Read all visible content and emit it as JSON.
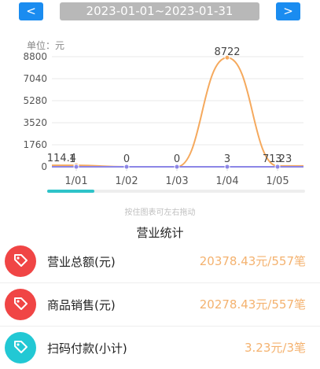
{
  "header": {
    "prev_label": "<",
    "next_label": ">",
    "date_range": "2023-01-01~2023-01-31"
  },
  "chart_data": {
    "type": "line",
    "unit_label": "单位：元",
    "x": [
      "1/01",
      "1/02",
      "1/03",
      "1/04",
      "1/05"
    ],
    "y_ticks": [
      "8800",
      "7040",
      "5280",
      "3520",
      "1760",
      "0"
    ],
    "ylim": [
      0,
      8800
    ],
    "series": [
      {
        "color": "#f5a95d",
        "values": [
          114.4,
          0,
          0,
          8722,
          71.23
        ],
        "labels": [
          "114.4",
          "0",
          "0",
          "8722",
          "71.23"
        ]
      },
      {
        "color": "#8c86e6",
        "values": [
          1,
          0,
          0,
          3,
          3
        ],
        "labels": [
          "1",
          "",
          "",
          "3",
          "3"
        ]
      }
    ],
    "grid": true
  },
  "hint": "按住图表可左右拖动",
  "section_title": "营业统计",
  "stats": [
    {
      "label": "营业总额(元)",
      "value": "20378.43元/557笔",
      "icon_color": "#f04545",
      "icon": "tag-icon"
    },
    {
      "label": "商品销售(元)",
      "value": "20278.43元/557笔",
      "icon_color": "#f04545",
      "icon": "tag-icon"
    },
    {
      "label": "扫码付款(小计)",
      "value": "3.23元/3笔",
      "icon_color": "#22c8d4",
      "icon": "tag-icon"
    }
  ]
}
